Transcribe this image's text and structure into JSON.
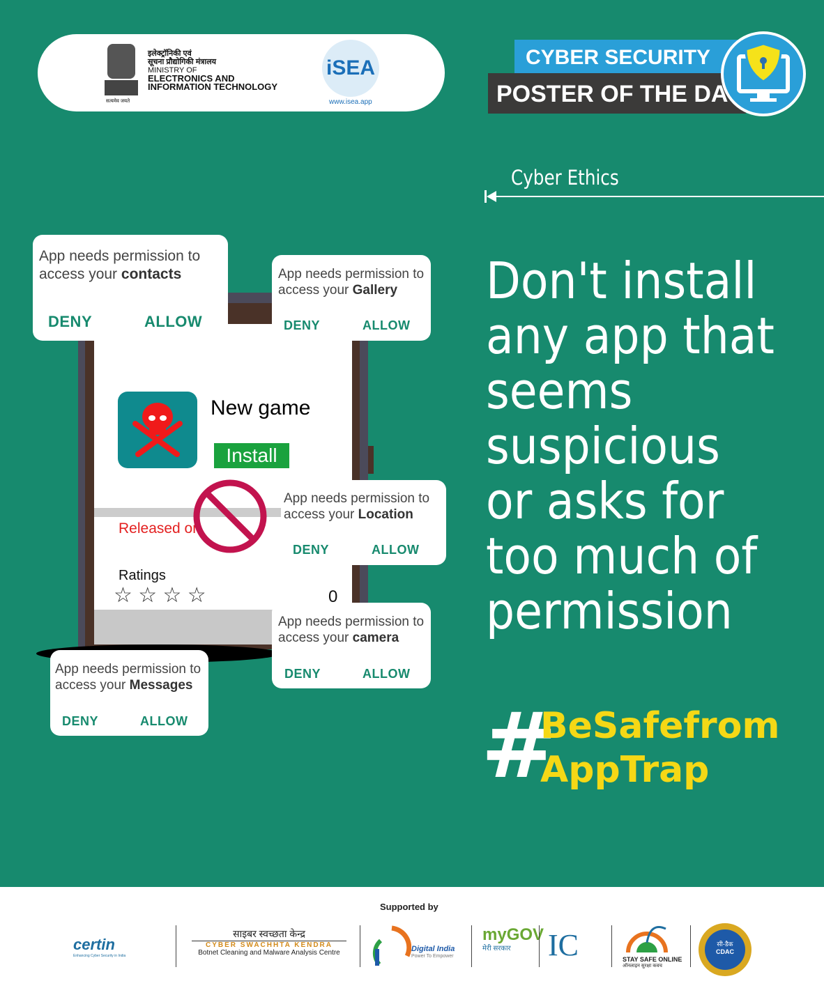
{
  "header": {
    "ministry_hindi_1": "इलेक्ट्रॉनिकी एवं",
    "ministry_hindi_2": "सूचना प्रौद्योगिकी मंत्रालय",
    "ministry_line1": "MINISTRY OF",
    "ministry_line2": "ELECTRONICS AND",
    "ministry_line3": "INFORMATION TECHNOLOGY",
    "emblem_motto": "सत्यमेव जयते",
    "isea_logo": "iSEA",
    "isea_url": "www.isea.app"
  },
  "banner": {
    "line1": "CYBER SECURITY",
    "line2": "POSTER OF THE DAY",
    "icon": "shield-lock-monitor-icon",
    "accent": "#2a9fd8"
  },
  "category": "Cyber Ethics",
  "app": {
    "name": "New game",
    "install_label": "Install",
    "released_label": "Released on",
    "ratings_label": "Ratings",
    "ratings_count": "0",
    "stars": "☆ ☆ ☆ ☆",
    "icon": "skull-crossbones-icon",
    "forbidden_icon": "no-entry-icon"
  },
  "dialogs": [
    {
      "prefix": "App needs permission to access your ",
      "item": "contacts",
      "deny": "DENY",
      "allow": "ALLOW"
    },
    {
      "prefix": "App needs permission to access your ",
      "item": "Gallery",
      "deny": "DENY",
      "allow": "ALLOW"
    },
    {
      "prefix": "App needs permission to access your ",
      "item": "Location",
      "deny": "DENY",
      "allow": "ALLOW"
    },
    {
      "prefix": "App needs permission to access your ",
      "item": "camera",
      "deny": "DENY",
      "allow": "ALLOW"
    },
    {
      "prefix": "App needs permission to access your ",
      "item": "Messages",
      "deny": "DENY",
      "allow": "ALLOW"
    }
  ],
  "headline": "Don't install any app that seems suspicious or asks for too much of permission",
  "hashtag": {
    "symbol": "#",
    "line1": "BeSafefrom",
    "line2": "AppTrap",
    "color": "#f5d816"
  },
  "footer": {
    "supported_by": "Supported by",
    "logos": [
      {
        "name": "cert-in",
        "text": "certin",
        "sub": "Enhancing Cyber Security in India"
      },
      {
        "name": "cyber-swachhta-kendra",
        "hindi": "साइबर स्वच्छता केन्द्र",
        "text": "CYBER SWACHHTA KENDRA",
        "sub": "Botnet Cleaning and Malware Analysis Centre"
      },
      {
        "name": "digital-india",
        "text": "Digital India",
        "sub": "Power To Empower"
      },
      {
        "name": "mygov",
        "text": "myGOV",
        "sub": "मेरी सरकार"
      },
      {
        "name": "ic",
        "text": "IC"
      },
      {
        "name": "stay-safe-online",
        "text": "STAY SAFE ONLINE",
        "sub": "ऑनलाइन सुरक्षा कवच"
      },
      {
        "name": "cdac",
        "hindi": "सी-डैक",
        "text": "CDAC"
      }
    ]
  }
}
